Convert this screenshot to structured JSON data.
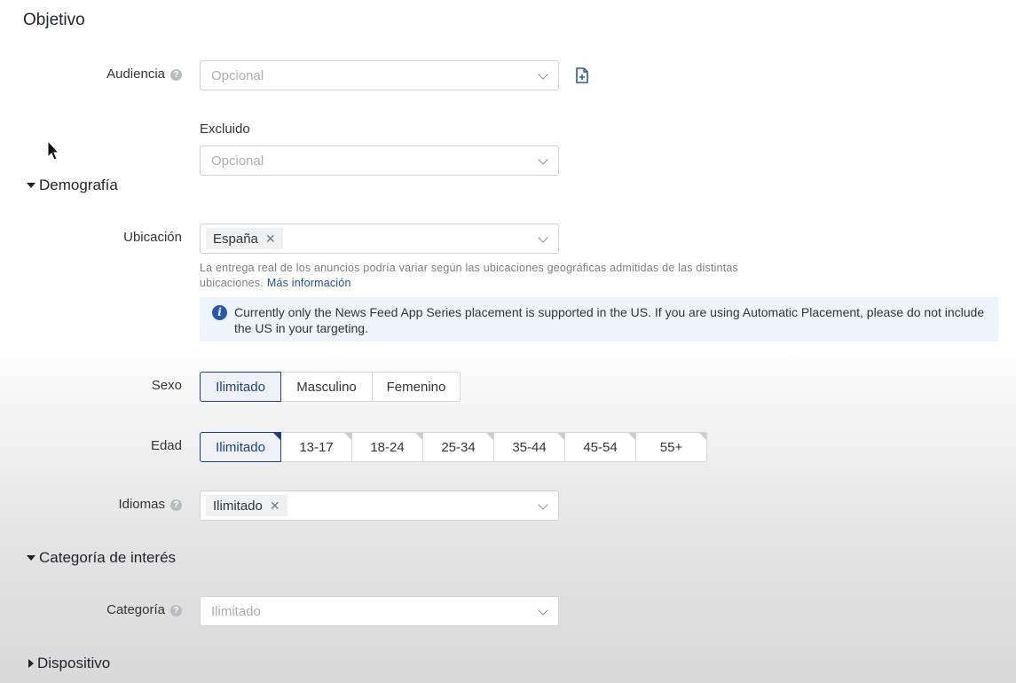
{
  "page_title": "Objetivo",
  "audience": {
    "label": "Audiencia",
    "placeholder": "Opcional",
    "excluded_label": "Excluido",
    "excluded_placeholder": "Opcional"
  },
  "demography": {
    "section_label": "Demografía",
    "location": {
      "label": "Ubicación",
      "tag": "España",
      "hint": "La entrega real de los anuncios podría variar según las ubicaciones geográficas admitidas de las distintas ubicaciones.",
      "link": "Más información"
    },
    "notice": "Currently only the News Feed App Series placement is supported in the US. If you are using Automatic Placement, please do not include the US in your targeting.",
    "sex": {
      "label": "Sexo",
      "options": [
        "Ilimitado",
        "Masculino",
        "Femenino"
      ],
      "selected": "Ilimitado"
    },
    "age": {
      "label": "Edad",
      "options": [
        "Ilimitado",
        "13-17",
        "18-24",
        "25-34",
        "35-44",
        "45-54",
        "55+"
      ],
      "selected": "Ilimitado"
    },
    "languages": {
      "label": "Idiomas",
      "tag": "Ilimitado"
    }
  },
  "interest": {
    "section_label": "Categoría de interés",
    "category": {
      "label": "Categoría",
      "placeholder": "Ilimitado"
    }
  },
  "device": {
    "section_label": "Dispositivo"
  },
  "icons": {
    "help": "help-icon",
    "info": "info-icon",
    "file_add": "file-add-icon",
    "caret": "chevron-down-icon",
    "close": "close-icon",
    "section_expanded": "triangle-down-icon",
    "section_collapsed": "triangle-right-icon",
    "cursor": "mouse-cursor-icon"
  },
  "colors": {
    "accent": "#1c3f8a",
    "link": "#1d4ea3",
    "notice_bg": "#eef4fb"
  }
}
